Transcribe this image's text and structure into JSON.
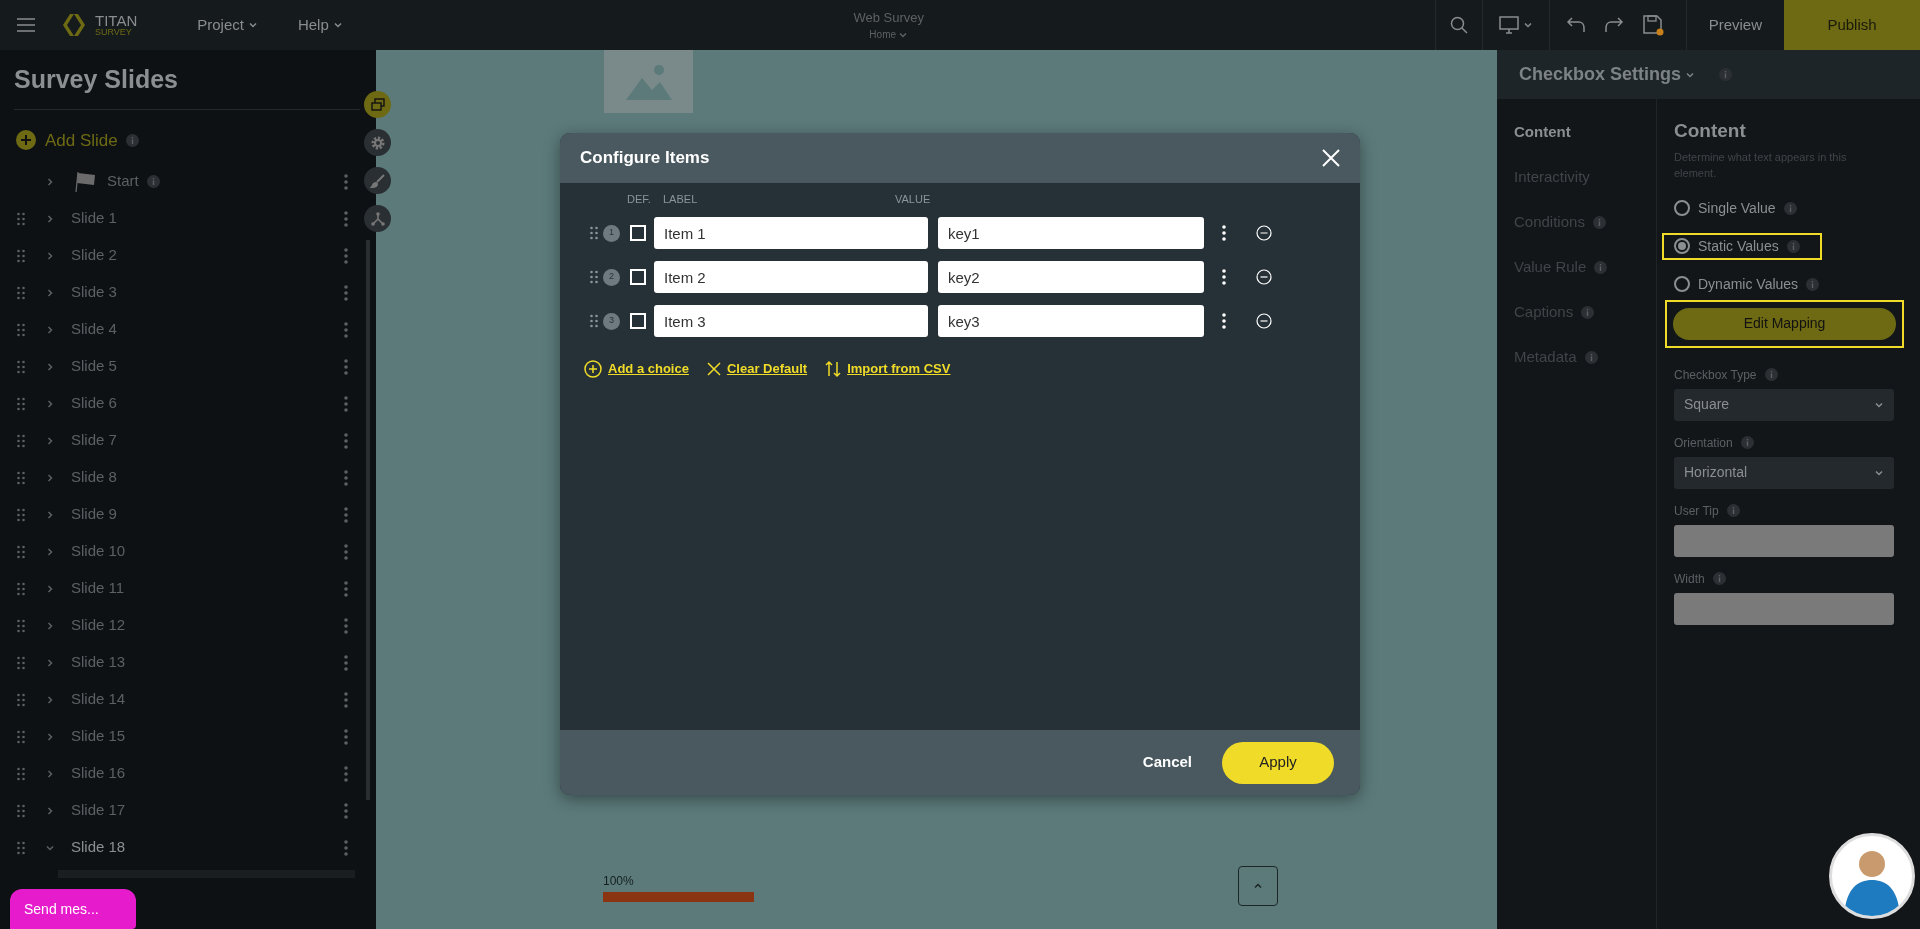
{
  "topbar": {
    "logo": {
      "name": "TITAN",
      "sub": "SURVEY"
    },
    "menus": [
      "Project",
      "Help"
    ],
    "title": "Web Survey",
    "subtitle": "Home",
    "preview": "Preview",
    "publish": "Publish"
  },
  "sidebar": {
    "title": "Survey Slides",
    "add": "Add Slide",
    "tools": [
      {
        "kind": "layers",
        "selected": true
      },
      {
        "kind": "gear",
        "selected": false
      },
      {
        "kind": "brush",
        "selected": false
      },
      {
        "kind": "flow",
        "selected": false
      }
    ],
    "items": [
      {
        "kind": "start",
        "label": "Start",
        "expanded": false
      },
      {
        "kind": "slide",
        "label": "Slide 1",
        "expanded": false
      },
      {
        "kind": "slide",
        "label": "Slide 2",
        "expanded": false
      },
      {
        "kind": "slide",
        "label": "Slide 3",
        "expanded": false
      },
      {
        "kind": "slide",
        "label": "Slide 4",
        "expanded": false
      },
      {
        "kind": "slide",
        "label": "Slide 5",
        "expanded": false
      },
      {
        "kind": "slide",
        "label": "Slide 6",
        "expanded": false
      },
      {
        "kind": "slide",
        "label": "Slide 7",
        "expanded": false
      },
      {
        "kind": "slide",
        "label": "Slide 8",
        "expanded": false
      },
      {
        "kind": "slide",
        "label": "Slide 9",
        "expanded": false
      },
      {
        "kind": "slide",
        "label": "Slide 10",
        "expanded": false
      },
      {
        "kind": "slide",
        "label": "Slide 11",
        "expanded": false
      },
      {
        "kind": "slide",
        "label": "Slide 12",
        "expanded": false
      },
      {
        "kind": "slide",
        "label": "Slide 13",
        "expanded": false
      },
      {
        "kind": "slide",
        "label": "Slide 14",
        "expanded": false
      },
      {
        "kind": "slide",
        "label": "Slide 15",
        "expanded": false
      },
      {
        "kind": "slide",
        "label": "Slide 16",
        "expanded": false
      },
      {
        "kind": "slide",
        "label": "Slide 17",
        "expanded": false
      },
      {
        "kind": "slide",
        "label": "Slide 18",
        "expanded": true
      }
    ],
    "chat": "Send mes..."
  },
  "canvas": {
    "progress": {
      "reading": "100%",
      "level": 1
    }
  },
  "dialog": {
    "title": "Configure Items",
    "columns": [
      "DEF.",
      "LABEL",
      "VALUE"
    ],
    "rows": [
      {
        "index": "1",
        "checked": false,
        "label": "Item 1",
        "value": "key1"
      },
      {
        "index": "2",
        "checked": false,
        "label": "Item 2",
        "value": "key2"
      },
      {
        "index": "3",
        "checked": false,
        "label": "Item 3",
        "value": "key3"
      }
    ],
    "actions": [
      {
        "kind": "add",
        "label": "Add a choice"
      },
      {
        "kind": "clear",
        "label": "Clear Default"
      },
      {
        "kind": "import",
        "label": "Import from CSV"
      }
    ],
    "cancel": "Cancel",
    "apply": "Apply"
  },
  "settings": {
    "title": "Checkbox Settings",
    "nav": [
      {
        "label": "Content",
        "selected": true,
        "info": false
      },
      {
        "label": "Interactivity",
        "selected": false,
        "info": false
      },
      {
        "label": "Conditions",
        "selected": false,
        "info": true
      },
      {
        "label": "Value Rule",
        "selected": false,
        "info": true
      },
      {
        "label": "Captions",
        "selected": false,
        "info": true
      },
      {
        "label": "Metadata",
        "selected": false,
        "info": true
      }
    ],
    "heading": "Content",
    "description": "Determine what text appears in this element.",
    "options": [
      {
        "label": "Single Value",
        "selected": false,
        "highlighted": false
      },
      {
        "label": "Static Values",
        "selected": true,
        "highlighted": true
      },
      {
        "label": "Dynamic Values",
        "selected": false,
        "highlighted": false
      }
    ],
    "mapping": {
      "label": "Edit Mapping",
      "highlighted": true
    },
    "fields": [
      {
        "kind": "select",
        "label": "Checkbox Type",
        "value": "Square"
      },
      {
        "kind": "select",
        "label": "Orientation",
        "value": "Horizontal"
      },
      {
        "kind": "input",
        "label": "User Tip"
      },
      {
        "kind": "input",
        "label": "Width"
      }
    ]
  }
}
